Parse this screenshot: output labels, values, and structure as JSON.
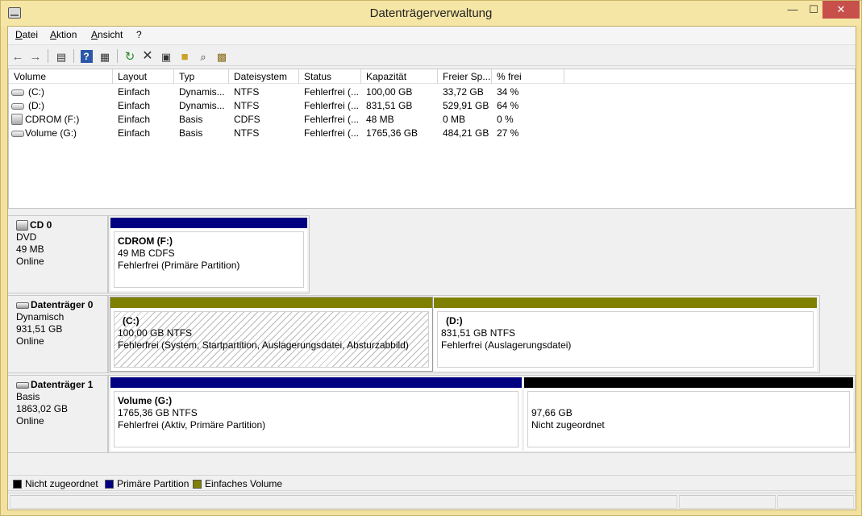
{
  "window": {
    "title": "Datenträgerverwaltung",
    "minimize": "—",
    "maximize": "☐",
    "close": "✕"
  },
  "menu": {
    "items": [
      "Datei",
      "Aktion",
      "Ansicht",
      "?"
    ]
  },
  "toolbar": {
    "buttons": [
      "back-arrow-icon",
      "forward-arrow-icon",
      "console-tree-icon",
      "help-icon",
      "properties-view-icon",
      "refresh-icon",
      "delete-icon",
      "properties-icon",
      "open-icon",
      "search-icon",
      "export-icon"
    ]
  },
  "volumes": {
    "columns": [
      "Volume",
      "Layout",
      "Typ",
      "Dateisystem",
      "Status",
      "Kapazität",
      "Freier Sp...",
      "% frei"
    ],
    "rows": [
      {
        "volume": "(C:)",
        "layout": "Einfach",
        "typ": "Dynamis...",
        "fs": "NTFS",
        "status": "Fehlerfrei (...",
        "capacity": "100,00 GB",
        "free": "33,72 GB",
        "pct": "34 %",
        "icon": "drive-icon"
      },
      {
        "volume": "(D:)",
        "layout": "Einfach",
        "typ": "Dynamis...",
        "fs": "NTFS",
        "status": "Fehlerfrei (...",
        "capacity": "831,51 GB",
        "free": "529,91 GB",
        "pct": "64 %",
        "icon": "drive-icon"
      },
      {
        "volume": "CDROM (F:)",
        "layout": "Einfach",
        "typ": "Basis",
        "fs": "CDFS",
        "status": "Fehlerfrei (...",
        "capacity": "48 MB",
        "free": "0 MB",
        "pct": "0 %",
        "icon": "cdrom-icon"
      },
      {
        "volume": "Volume (G:)",
        "layout": "Einfach",
        "typ": "Basis",
        "fs": "NTFS",
        "status": "Fehlerfrei (...",
        "capacity": "1765,36 GB",
        "free": "484,21 GB",
        "pct": "27 %",
        "icon": "drive-icon"
      }
    ]
  },
  "disks": [
    {
      "name": "CD 0",
      "type": "DVD",
      "size": "49 MB",
      "state": "Online",
      "partitions": [
        {
          "title": "CDROM  (F:)",
          "line1": "49 MB CDFS",
          "line2": "Fehlerfrei (Primäre Partition)",
          "color": "#000080"
        }
      ]
    },
    {
      "name": "Datenträger 0",
      "type": "Dynamisch",
      "size": "931,51 GB",
      "state": "Online",
      "partitions": [
        {
          "title": "(C:)",
          "line1": "100,00 GB NTFS",
          "line2": "Fehlerfrei (System, Startpartition, Auslagerungsdatei, Absturzabbild)",
          "color": "#808000"
        },
        {
          "title": "(D:)",
          "line1": "831,51 GB NTFS",
          "line2": "Fehlerfrei (Auslagerungsdatei)",
          "color": "#808000"
        }
      ]
    },
    {
      "name": "Datenträger 1",
      "type": "Basis",
      "size": "1863,02 GB",
      "state": "Online",
      "partitions": [
        {
          "title": "Volume  (G:)",
          "line1": "1765,36 GB NTFS",
          "line2": "Fehlerfrei (Aktiv, Primäre Partition)",
          "color": "#000080"
        },
        {
          "title": "",
          "line1": "97,66 GB",
          "line2": "Nicht zugeordnet",
          "color": "#000000"
        }
      ]
    }
  ],
  "legend": {
    "items": [
      {
        "label": "Nicht zugeordnet",
        "color": "#000000"
      },
      {
        "label": "Primäre Partition",
        "color": "#000080"
      },
      {
        "label": "Einfaches Volume",
        "color": "#808000"
      }
    ]
  }
}
